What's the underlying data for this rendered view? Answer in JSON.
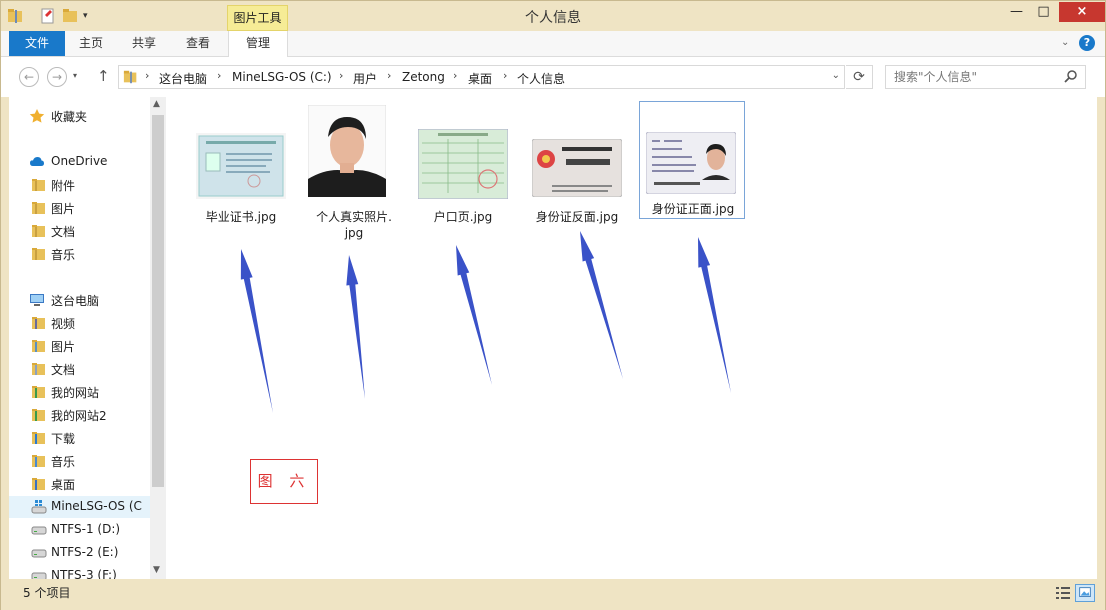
{
  "window": {
    "title": "个人信息",
    "close_label": "×",
    "min_label": "—",
    "max_label": "□",
    "help_label": "?"
  },
  "ribbon": {
    "contextual_group": "图片工具",
    "tabs": [
      {
        "label": "文件"
      },
      {
        "label": "主页"
      },
      {
        "label": "共享"
      },
      {
        "label": "查看"
      },
      {
        "label": "管理"
      }
    ]
  },
  "address": {
    "breadcrumbs": [
      "这台电脑",
      "MineLSG-OS (C:)",
      "用户",
      "Zetong",
      "桌面",
      "个人信息"
    ],
    "search_placeholder": "搜索\"个人信息\""
  },
  "nav": {
    "items": [
      {
        "label": "收藏夹",
        "icon": "star-icon"
      },
      {
        "label": "OneDrive",
        "icon": "cloud-icon"
      },
      {
        "label": "附件",
        "icon": "folder-icon"
      },
      {
        "label": "图片",
        "icon": "folder-icon"
      },
      {
        "label": "文档",
        "icon": "folder-icon"
      },
      {
        "label": "音乐",
        "icon": "folder-icon"
      },
      {
        "label": "这台电脑",
        "icon": "computer-icon"
      },
      {
        "label": "视频",
        "icon": "video-folder-icon"
      },
      {
        "label": "图片",
        "icon": "pictures-folder-icon"
      },
      {
        "label": "文档",
        "icon": "documents-folder-icon"
      },
      {
        "label": "我的网站",
        "icon": "network-folder-icon"
      },
      {
        "label": "我的网站2",
        "icon": "network-folder-icon"
      },
      {
        "label": "下载",
        "icon": "downloads-folder-icon"
      },
      {
        "label": "音乐",
        "icon": "music-folder-icon"
      },
      {
        "label": "桌面",
        "icon": "desktop-folder-icon"
      },
      {
        "label": "MineLSG-OS (C",
        "icon": "system-drive-icon"
      },
      {
        "label": "NTFS-1 (D:)",
        "icon": "drive-icon"
      },
      {
        "label": "NTFS-2 (E:)",
        "icon": "drive-icon"
      },
      {
        "label": "NTFS-3 (F:)",
        "icon": "drive-icon"
      }
    ]
  },
  "files": [
    {
      "name": "毕业证书.jpg"
    },
    {
      "name": "个人真实照片.\njpg"
    },
    {
      "name": "户口页.jpg"
    },
    {
      "name": "身份证反面.jpg"
    },
    {
      "name": "身份证正面.jpg"
    }
  ],
  "annotation": {
    "label": "图 六"
  },
  "status": {
    "item_count": "5 个项目"
  },
  "colors": {
    "accent": "#1979ca",
    "arrow": "#3a52c8",
    "annotation": "#dd3333",
    "selection": "#7aa5d8"
  }
}
